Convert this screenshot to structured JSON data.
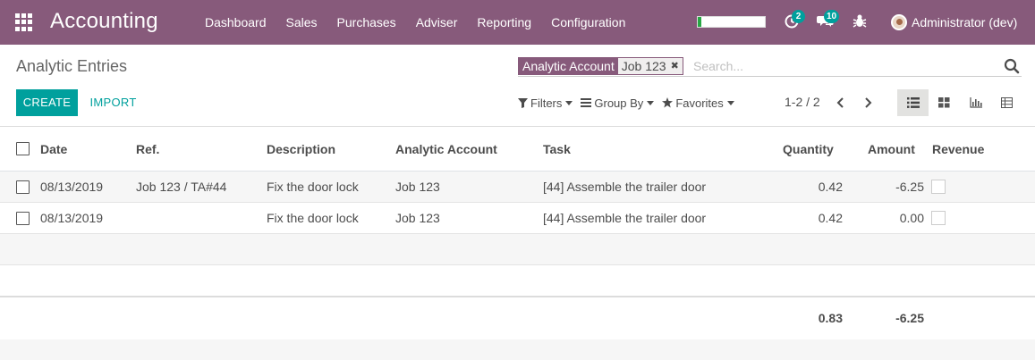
{
  "navbar": {
    "app_title": "Accounting",
    "menu": [
      "Dashboard",
      "Sales",
      "Purchases",
      "Adviser",
      "Reporting",
      "Configuration"
    ],
    "activity_badge": "2",
    "messages_badge": "10",
    "user_name": "Administrator (dev)",
    "progress_fraction": 0.05,
    "color": "#875a7b"
  },
  "control": {
    "page_title": "Analytic Entries",
    "search": {
      "facet_label": "Analytic Account",
      "facet_value": "Job 123",
      "placeholder": "Search..."
    },
    "create_label": "CREATE",
    "import_label": "IMPORT",
    "filters_label": "Filters",
    "groupby_label": "Group By",
    "favorites_label": "Favorites",
    "pager": "1-2 / 2",
    "accent": "#00a09d"
  },
  "table": {
    "columns": [
      "Date",
      "Ref.",
      "Description",
      "Analytic Account",
      "Task",
      "Quantity",
      "Amount",
      "Revenue"
    ],
    "rows": [
      {
        "date": "08/13/2019",
        "ref": "Job 123 / TA#44",
        "description": "Fix the door lock",
        "account": "Job 123",
        "task": "[44] Assemble the trailer door",
        "quantity": "0.42",
        "amount": "-6.25"
      },
      {
        "date": "08/13/2019",
        "ref": "",
        "description": "Fix the door lock",
        "account": "Job 123",
        "task": "[44] Assemble the trailer door",
        "quantity": "0.42",
        "amount": "0.00"
      }
    ],
    "totals": {
      "quantity": "0.83",
      "amount": "-6.25"
    }
  }
}
